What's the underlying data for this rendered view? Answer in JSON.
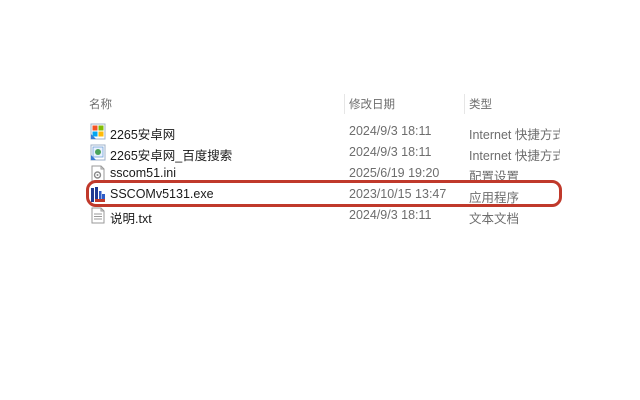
{
  "columns": {
    "name": "名称",
    "date": "修改日期",
    "type": "类型"
  },
  "files": [
    {
      "name": "2265安卓网",
      "date": "2024/9/3 18:11",
      "type": "Internet 快捷方式",
      "icon": "internet-shortcut-icon"
    },
    {
      "name": "2265安卓网_百度搜索",
      "date": "2024/9/3 18:11",
      "type": "Internet 快捷方式",
      "icon": "internet-shortcut-icon"
    },
    {
      "name": "sscom51.ini",
      "date": "2025/6/19 19:20",
      "type": "配置设置",
      "icon": "config-file-icon"
    },
    {
      "name": "SSCOMv5131.exe",
      "date": "2023/10/15 13:47",
      "type": "应用程序",
      "icon": "sscom-app-icon"
    },
    {
      "name": "说明.txt",
      "date": "2024/9/3 18:11",
      "type": "文本文档",
      "icon": "text-file-icon"
    }
  ],
  "highlight_color": "#c0392b"
}
